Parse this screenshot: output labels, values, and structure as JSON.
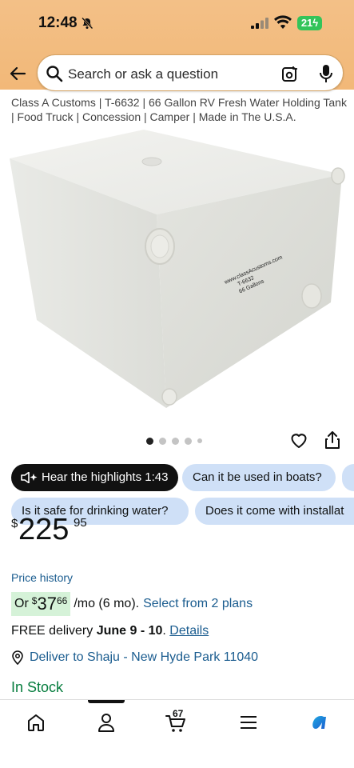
{
  "status_bar": {
    "time": "12:48",
    "battery": "21"
  },
  "search": {
    "placeholder": "Search or ask a question"
  },
  "product": {
    "title": "Class A Customs | T-6632 | 66 Gallon RV Fresh Water Holding Tank | Food Truck | Concession | Camper | Made in The U.S.A.",
    "image_label_lines": [
      "www.classAcustoms.com",
      "T-6632",
      "66 Gallons"
    ]
  },
  "carousel": {
    "image_count": 5,
    "active_index": 0
  },
  "highlight_chip": {
    "label": "Hear the highlights 1:43"
  },
  "question_chips": [
    "Can it be used in boats?",
    "Is it safe for drinking water?",
    "Does it come with installat"
  ],
  "price": {
    "symbol": "$",
    "whole": "225",
    "fraction": "95"
  },
  "price_history_label": "Price history",
  "plan": {
    "prefix": "Or",
    "symbol": "$",
    "whole": "37",
    "fraction": "66",
    "suffix": "/mo (6 mo).",
    "link": "Select from 2 plans"
  },
  "delivery": {
    "prefix": "FREE delivery",
    "dates": "June 9 - 10",
    "link": "Details"
  },
  "deliver_to": {
    "label": "Deliver to Shaju - New Hyde Park 11040"
  },
  "stock_status": "In Stock",
  "tabbar": {
    "cart_count": "67",
    "active_tab": "account"
  },
  "colors": {
    "header": "#f2bb7d",
    "link": "#1a5c8f",
    "stock": "#067d3e",
    "chip": "#cfe0f7"
  }
}
